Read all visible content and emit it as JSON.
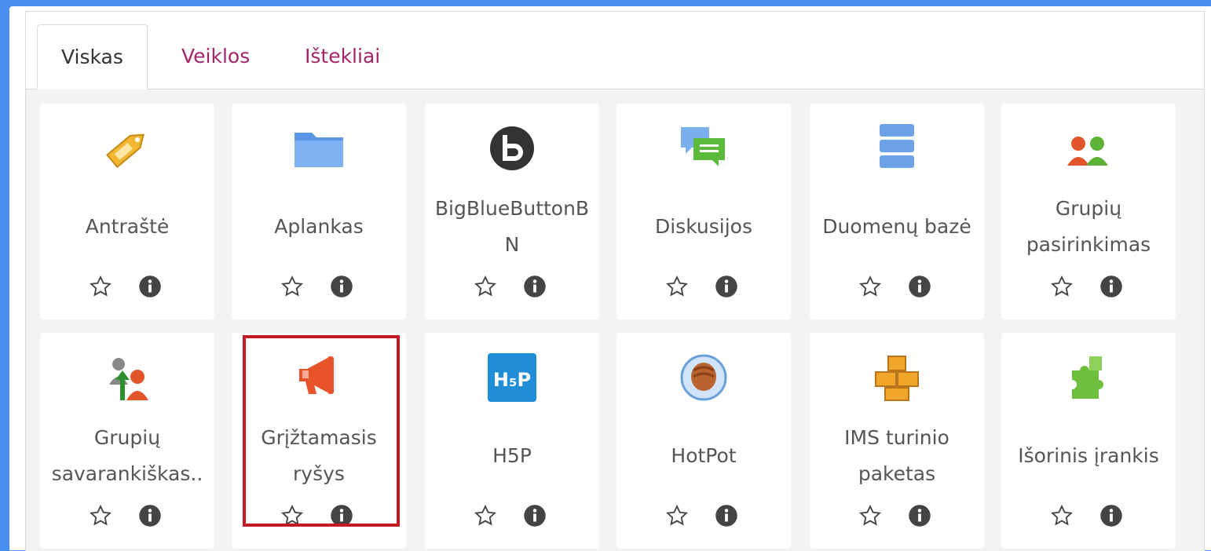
{
  "tabs": [
    {
      "label": "Viskas",
      "active": true
    },
    {
      "label": "Veiklos",
      "active": false
    },
    {
      "label": "Ištekliai",
      "active": false
    }
  ],
  "modules": [
    {
      "line1": "Antraštė",
      "line2": "",
      "icon": "label-tag-icon"
    },
    {
      "line1": "Aplankas",
      "line2": "",
      "icon": "folder-icon"
    },
    {
      "line1": "BigBlueButtonB",
      "line2": "N",
      "icon": "bigbluebutton-icon"
    },
    {
      "line1": "Diskusijos",
      "line2": "",
      "icon": "forum-icon"
    },
    {
      "line1": "Duomenų bazė",
      "line2": "",
      "icon": "database-icon"
    },
    {
      "line1": "Grupių",
      "line2": "pasirinkimas",
      "icon": "group-choice-icon"
    },
    {
      "line1": "Grupių",
      "line2": "savarankiškas..",
      "icon": "group-selfselect-icon"
    },
    {
      "line1": "Grįžtamasis",
      "line2": "ryšys",
      "icon": "feedback-megaphone-icon",
      "highlighted": true
    },
    {
      "line1": "H5P",
      "line2": "",
      "icon": "h5p-icon"
    },
    {
      "line1": "HotPot",
      "line2": "",
      "icon": "hotpot-icon"
    },
    {
      "line1": "IMS turinio",
      "line2": "paketas",
      "icon": "ims-package-icon"
    },
    {
      "line1": "Išorinis įrankis",
      "line2": "",
      "icon": "external-tool-puzzle-icon"
    }
  ],
  "icons": {
    "star": "star-outline-icon",
    "info": "info-circle-icon"
  },
  "colors": {
    "accent": "#4a8ff0",
    "tab_link": "#a32567",
    "highlight": "#c41a26"
  }
}
